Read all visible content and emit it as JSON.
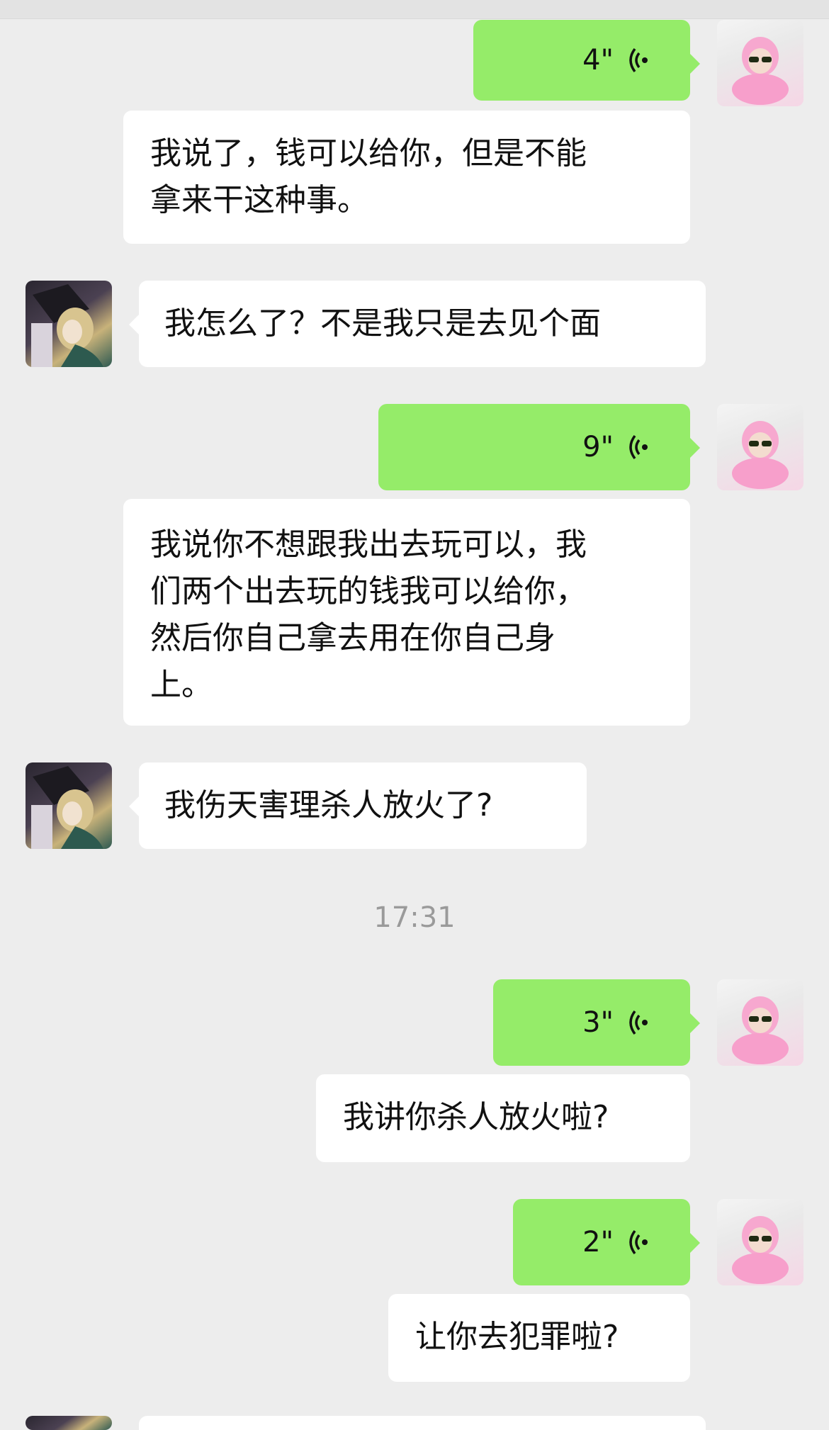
{
  "chat": {
    "messages": [
      {
        "sender": "self",
        "type": "voice",
        "duration": "4\""
      },
      {
        "sender": "self",
        "type": "transcript",
        "text": "我说了，钱可以给你，但是不能\n拿来干这种事。"
      },
      {
        "sender": "other",
        "type": "text",
        "text": "我怎么了？不是我只是去见个面"
      },
      {
        "sender": "self",
        "type": "voice",
        "duration": "9\""
      },
      {
        "sender": "self",
        "type": "transcript",
        "text": "我说你不想跟我出去玩可以，我\n们两个出去玩的钱我可以给你，\n然后你自己拿去用在你自己身\n上。"
      },
      {
        "sender": "other",
        "type": "text",
        "text": "我伤天害理杀人放火了?"
      },
      {
        "sender": "self",
        "type": "voice",
        "duration": "3\""
      },
      {
        "sender": "self",
        "type": "transcript",
        "text": "我讲你杀人放火啦?"
      },
      {
        "sender": "self",
        "type": "voice",
        "duration": "2\""
      },
      {
        "sender": "self",
        "type": "transcript",
        "text": "让你去犯罪啦?"
      }
    ],
    "timestamp": "17:31"
  },
  "icons": {
    "voice": "voice-wave-icon",
    "self_avatar": "avatar-pink-hood-icon",
    "other_avatar": "avatar-anime-icon"
  },
  "colors": {
    "background": "#ededed",
    "self_bubble": "#95ec69",
    "other_bubble": "#ffffff",
    "timestamp": "#9a9a9a"
  }
}
